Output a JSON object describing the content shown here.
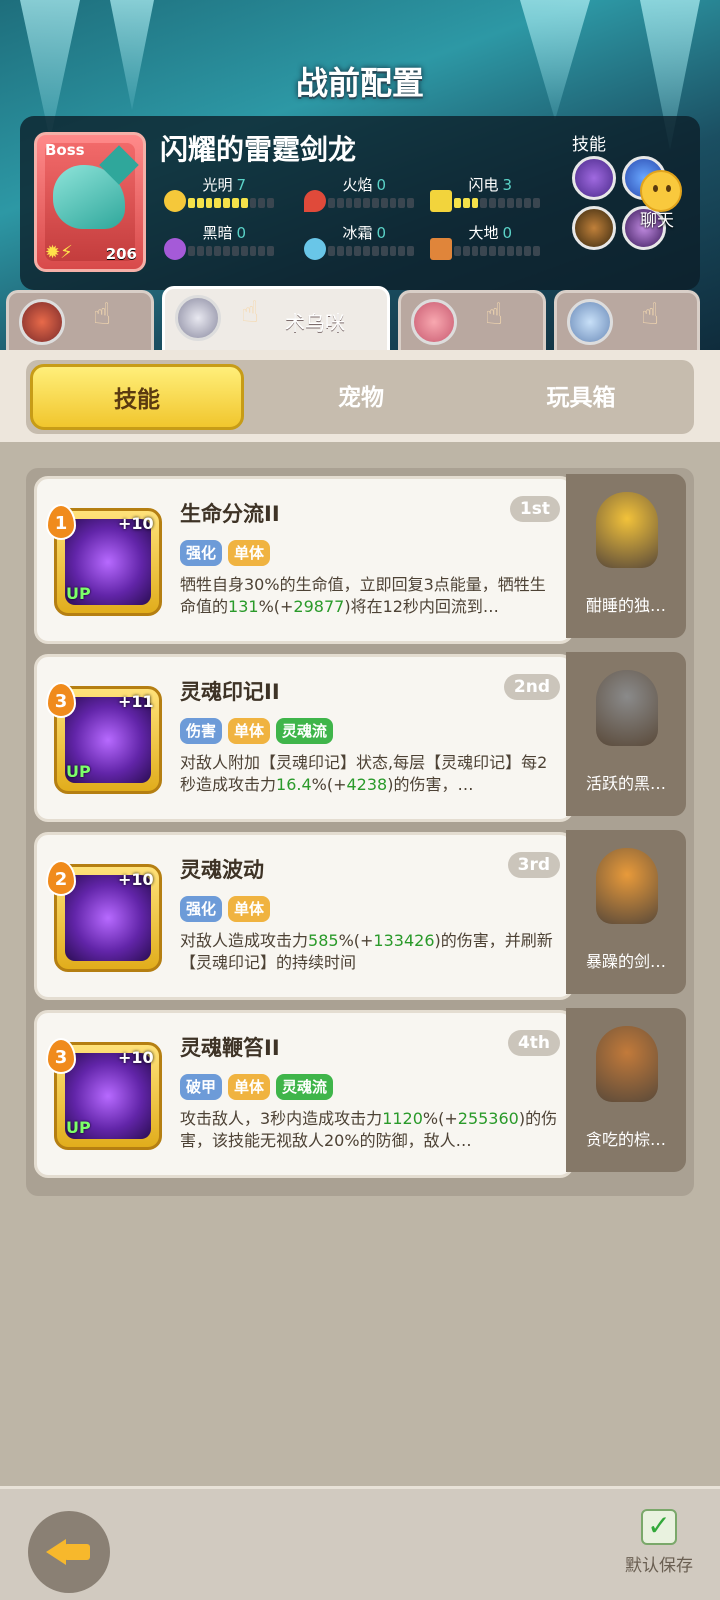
{
  "header": {
    "title": "战前配置"
  },
  "boss": {
    "tag": "Boss",
    "level": "206",
    "name": "闪耀的雷霆剑龙",
    "stats": [
      {
        "label": "光明",
        "value": "7",
        "filled": 7
      },
      {
        "label": "火焰",
        "value": "0",
        "filled": 0
      },
      {
        "label": "闪电",
        "value": "3",
        "filled": 3
      },
      {
        "label": "黑暗",
        "value": "0",
        "filled": 0
      },
      {
        "label": "冰霜",
        "value": "0",
        "filled": 0
      },
      {
        "label": "大地",
        "value": "0",
        "filled": 0
      }
    ],
    "skills_title": "技能"
  },
  "chat": {
    "label": "聊天"
  },
  "hero_tabs": [
    {
      "name": "",
      "active": false
    },
    {
      "name": "术乌咪",
      "active": true
    },
    {
      "name": "",
      "active": false
    },
    {
      "name": "",
      "active": false
    }
  ],
  "tabs": {
    "skill": "技能",
    "pet": "宠物",
    "toybox": "玩具箱",
    "active": "技能"
  },
  "cards": [
    {
      "level": "1",
      "plus": "+10",
      "up": "UP",
      "name": "生命分流II",
      "rank": "1st",
      "tags": [
        {
          "text": "强化",
          "color": "blue"
        },
        {
          "text": "单体",
          "color": "orange"
        }
      ],
      "desc_a": "牺牲自身30%的生命值，立即回复3点能量，牺牲生命值的",
      "num1": "131",
      "desc_b": "%(+",
      "num2": "29877",
      "desc_c": ")将在12秒内回流到…",
      "pet": "酣睡的独…"
    },
    {
      "level": "3",
      "plus": "+11",
      "up": "UP",
      "name": "灵魂印记II",
      "rank": "2nd",
      "tags": [
        {
          "text": "伤害",
          "color": "blue"
        },
        {
          "text": "单体",
          "color": "orange"
        },
        {
          "text": "灵魂流",
          "color": "green"
        }
      ],
      "desc_a": "对敌人附加【灵魂印记】状态,每层【灵魂印记】每2秒造成攻击力",
      "num1": "16.4",
      "desc_b": "%(+",
      "num2": "4238",
      "desc_c": ")的伤害，…",
      "pet": "活跃的黑…"
    },
    {
      "level": "2",
      "plus": "+10",
      "up": "",
      "name": "灵魂波动",
      "rank": "3rd",
      "tags": [
        {
          "text": "强化",
          "color": "blue"
        },
        {
          "text": "单体",
          "color": "orange"
        }
      ],
      "desc_a": "对敌人造成攻击力",
      "num1": "585",
      "desc_b": "%(+",
      "num2": "133426",
      "desc_c": ")的伤害，并刷新【灵魂印记】的持续时间",
      "pet": "暴躁的剑…"
    },
    {
      "level": "3",
      "plus": "+10",
      "up": "UP",
      "name": "灵魂鞭笞II",
      "rank": "4th",
      "tags": [
        {
          "text": "破甲",
          "color": "blue"
        },
        {
          "text": "单体",
          "color": "orange"
        },
        {
          "text": "灵魂流",
          "color": "green"
        }
      ],
      "desc_a": "攻击敌人，3秒内造成攻击力",
      "num1": "1120",
      "desc_b": "%(+",
      "num2": "255360",
      "desc_c": ")的伤害，该技能无视敌人20%的防御，敌人…",
      "pet": "贪吃的棕…"
    }
  ],
  "footer": {
    "save_label": "默认保存",
    "save_checked": true
  }
}
